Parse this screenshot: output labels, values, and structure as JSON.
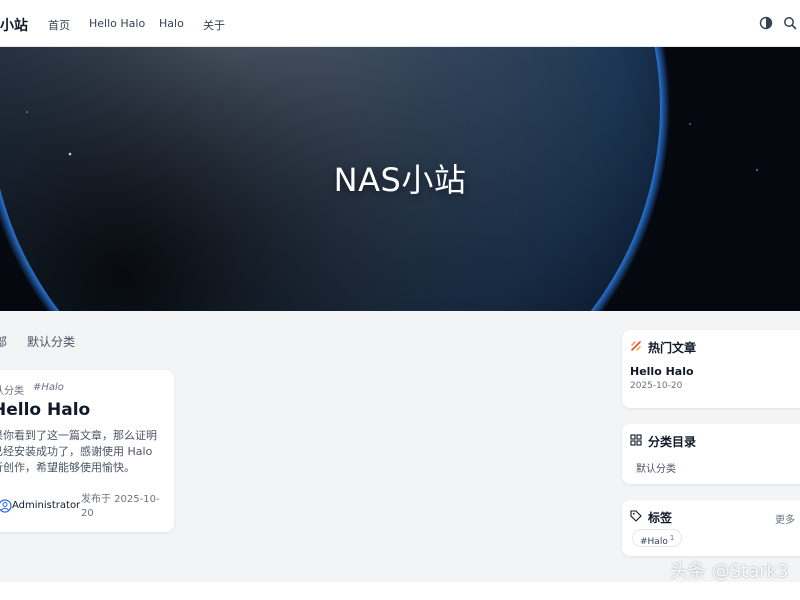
{
  "header": {
    "site_name": "小站",
    "nav": [
      "首页",
      "Hello Halo",
      "Halo",
      "关于"
    ],
    "icons": [
      "theme-toggle-icon",
      "search-icon"
    ]
  },
  "hero": {
    "title": "NAS小站"
  },
  "filter": {
    "items": [
      "部",
      "默认分类"
    ]
  },
  "post": {
    "category": "认分类",
    "tag": "#Halo",
    "title": "Hello Halo",
    "excerpt_lines": [
      "果你看到了这一篇文章，那么证明",
      "已经安装成功了，感谢使用 Halo",
      "行创作，希望能够使用愉快。"
    ],
    "author": "Administrator",
    "date": "发布于 2025-10-20"
  },
  "sidebar": {
    "hot": {
      "title": "热门文章",
      "post_title": "Hello Halo",
      "post_date": "2025-10-20"
    },
    "categories": {
      "title": "分类目录",
      "items": [
        "默认分类"
      ]
    },
    "tags": {
      "title": "标签",
      "more": "更多",
      "tag_name": "#Halo",
      "tag_count": "1"
    }
  },
  "watermark": "头条 @Stark3"
}
